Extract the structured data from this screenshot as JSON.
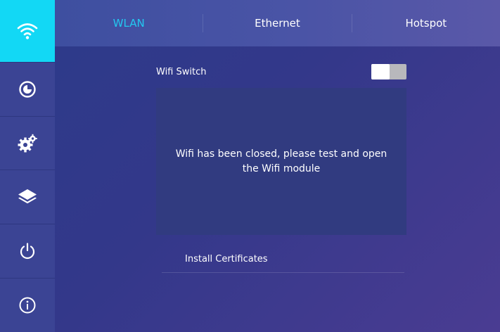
{
  "sidebar": {
    "items": [
      {
        "icon": "wifi-icon",
        "active": true
      },
      {
        "icon": "clock-pie-icon",
        "active": false
      },
      {
        "icon": "gear-icon",
        "active": false
      },
      {
        "icon": "layers-icon",
        "active": false
      },
      {
        "icon": "power-icon",
        "active": false
      },
      {
        "icon": "info-icon",
        "active": false
      }
    ],
    "active_color": "#12d8f5"
  },
  "tabs": [
    {
      "label": "WLAN",
      "active": true
    },
    {
      "label": "Ethernet",
      "active": false
    },
    {
      "label": "Hotspot",
      "active": false
    }
  ],
  "wifi": {
    "switch_label": "Wifi Switch",
    "switch_on": false,
    "message": "Wifi has been closed, please test and open\nthe Wifi module"
  },
  "certificates": {
    "label": "Install Certificates"
  },
  "colors": {
    "accent": "#23c8f0",
    "background": "#2c3b8a",
    "panel": "#313b80"
  }
}
